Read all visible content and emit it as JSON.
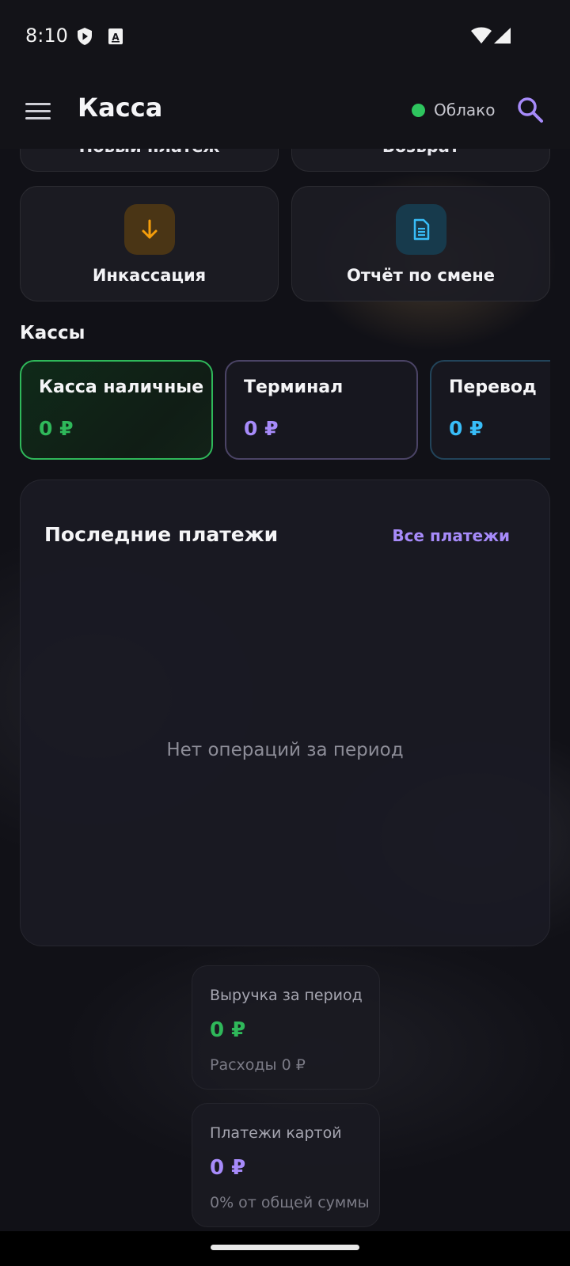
{
  "status_bar": {
    "time": "8:10",
    "icons": [
      "shield-icon",
      "autofill-icon",
      "wifi-icon",
      "cellular-signal-icon"
    ]
  },
  "app_bar": {
    "title": "Касса",
    "menu_icon": "hamburger-menu-icon",
    "cloud_status": "Облако",
    "cloud_status_color": "#2ec55e",
    "search_icon": "search-icon"
  },
  "actions": {
    "top_left_label": "Новый платеж",
    "top_right_label": "Возврат",
    "items": [
      {
        "label": "Инкассация",
        "icon": "arrow-down-icon",
        "icon_color": "#f59e0b"
      },
      {
        "label": "Отчёт по смене",
        "icon": "document-icon",
        "icon_color": "#38bdf8"
      }
    ]
  },
  "registers": {
    "title": "Кассы",
    "items": [
      {
        "name": "Касса наличные",
        "amount": "0 ₽",
        "color": "#2fb85a"
      },
      {
        "name": "Терминал",
        "amount": "0 ₽",
        "color": "#a78bfa"
      },
      {
        "name": "Перевод",
        "amount": "0 ₽",
        "color": "#38bdf8"
      }
    ]
  },
  "recent_payments": {
    "title": "Последние платежи",
    "all_link": "Все платежи",
    "empty_text": "Нет операций за период"
  },
  "stats": {
    "revenue": {
      "title": "Выручка за период",
      "value": "0 ₽",
      "sub": "Расходы 0 ₽",
      "color": "#2fb85a"
    },
    "card_payments": {
      "title": "Платежи картой",
      "value": "0 ₽",
      "sub": "0% от общей суммы",
      "color": "#a78bfa"
    }
  }
}
